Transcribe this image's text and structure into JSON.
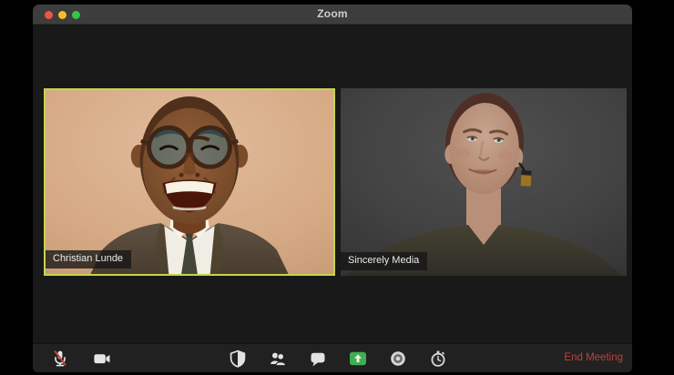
{
  "window": {
    "title": "Zoom"
  },
  "participants": [
    {
      "name": "Christian Lunde",
      "active_speaker": true
    },
    {
      "name": "Sincerely Media",
      "active_speaker": false
    }
  ],
  "toolbar": {
    "buttons": [
      {
        "id": "mute",
        "icon": "microphone-muted-icon",
        "state": "muted"
      },
      {
        "id": "video",
        "icon": "video-camera-icon",
        "state": "on"
      },
      {
        "id": "security",
        "icon": "shield-icon"
      },
      {
        "id": "participants",
        "icon": "participants-icon"
      },
      {
        "id": "chat",
        "icon": "chat-bubble-icon"
      },
      {
        "id": "share-screen",
        "icon": "share-screen-icon"
      },
      {
        "id": "record",
        "icon": "record-icon"
      },
      {
        "id": "reactions",
        "icon": "stopwatch-icon"
      }
    ],
    "end_meeting_label": "End Meeting"
  },
  "colors": {
    "window_bg": "#191919",
    "titlebar_bg": "#3d3d3d",
    "toolbar_bg": "#212121",
    "active_speaker_border": "#c6d44e",
    "share_screen_green": "#3fae52",
    "end_meeting_red": "#bf4038",
    "muted_slash_red": "#c2453e",
    "tl_close": "#ee5448",
    "tl_minimize": "#f6bd2e",
    "tl_zoom": "#35c648"
  }
}
